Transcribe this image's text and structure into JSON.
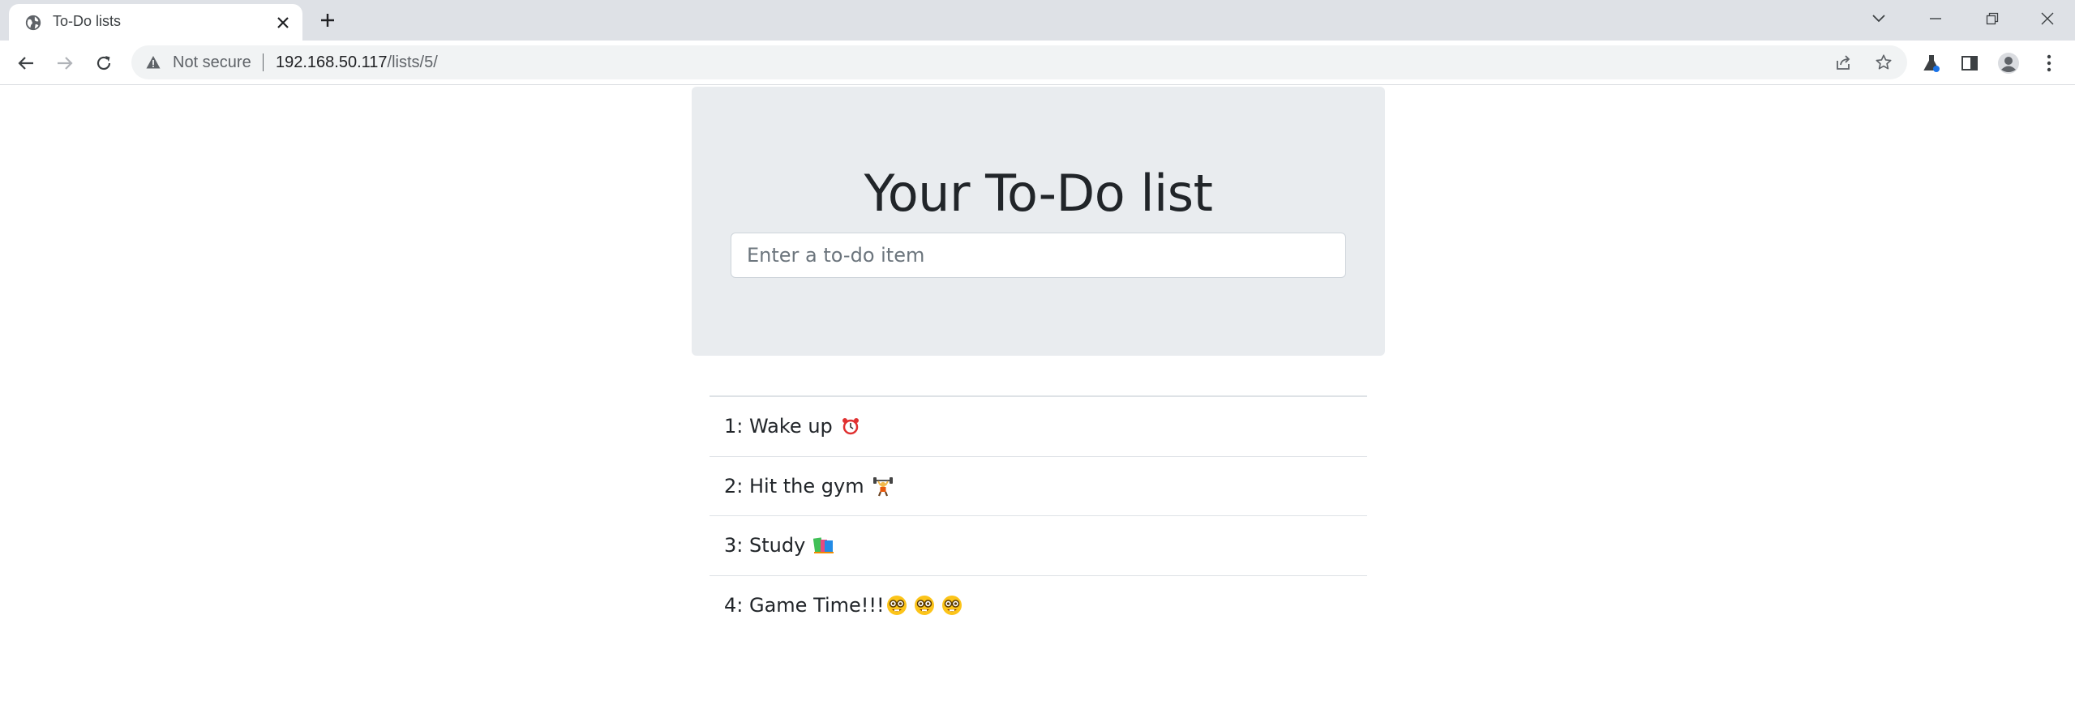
{
  "browser": {
    "tab": {
      "title": "To-Do lists",
      "favicon": "globe-icon"
    },
    "address_bar": {
      "security_label": "Not secure",
      "url_host": "192.168.50.117",
      "url_path": "/lists/5/"
    }
  },
  "page": {
    "heading": "Your To-Do list",
    "input_placeholder": "Enter a to-do item",
    "items": [
      {
        "text": "1: Wake up",
        "emoji": "alarm-clock-icon"
      },
      {
        "text": "2: Hit the gym",
        "emoji": "weightlifter-icon"
      },
      {
        "text": "3: Study",
        "emoji": "books-icon"
      },
      {
        "text": "4: Game Time!!!",
        "emoji": "nerd-face-icon"
      }
    ]
  },
  "colors": {
    "jumbotron_bg": "#e9ecef",
    "tabstrip_bg": "#dee1e6",
    "omnibox_bg": "#f1f3f4",
    "text_dark": "#212529"
  }
}
